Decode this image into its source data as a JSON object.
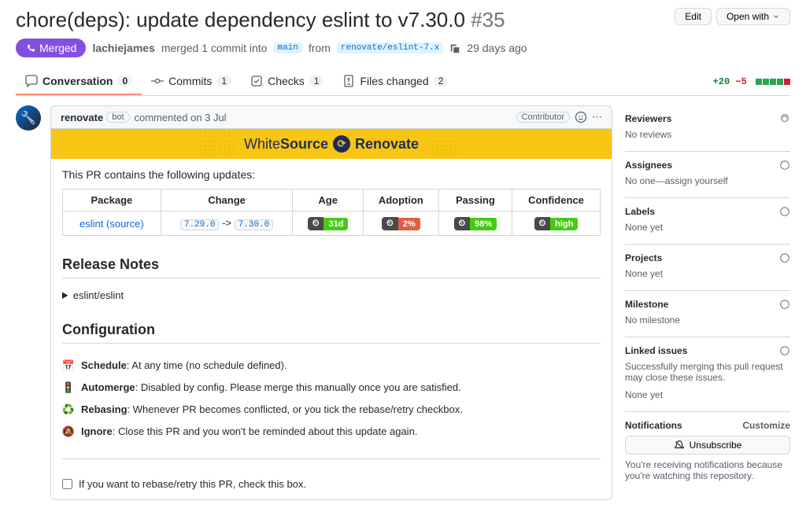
{
  "header": {
    "title": "chore(deps): update dependency eslint to v7.30.0",
    "issueNumber": "#35",
    "editBtn": "Edit",
    "openWithBtn": "Open with"
  },
  "state": {
    "badge": "Merged",
    "author": "lachiejames",
    "mergedText": "merged 1 commit into",
    "baseBranch": "main",
    "fromText": "from",
    "headBranch": "renovate/eslint-7.x",
    "timeAgo": "29 days ago"
  },
  "tabs": {
    "conversation": "Conversation",
    "conversationCount": "0",
    "commits": "Commits",
    "commitsCount": "1",
    "checks": "Checks",
    "checksCount": "1",
    "filesChanged": "Files changed",
    "filesChangedCount": "2",
    "additions": "+20",
    "deletions": "−5"
  },
  "comment": {
    "author": "renovate",
    "bot": "bot",
    "commentedText": "commented on 3 Jul",
    "contributor": "Contributor",
    "bannerLeft": "WhiteSource",
    "bannerRight": "Renovate",
    "introText": "This PR contains the following updates:",
    "table": {
      "headers": [
        "Package",
        "Change",
        "Age",
        "Adoption",
        "Passing",
        "Confidence"
      ],
      "package": "eslint",
      "sourceLabel": "(source)",
      "changeFrom": "7.29.0",
      "changeTo": "7.30.0",
      "arrow": "->",
      "age": "31d",
      "adoption": "2%",
      "passing": "98%",
      "confidence": "high"
    },
    "releaseNotesTitle": "Release Notes",
    "releaseNotesSummary": "eslint/eslint",
    "configTitle": "Configuration",
    "config": {
      "schedule": {
        "label": "Schedule",
        "text": ": At any time (no schedule defined)."
      },
      "automerge": {
        "label": "Automerge",
        "text": ": Disabled by config. Please merge this manually once you are satisfied."
      },
      "rebasing": {
        "label": "Rebasing",
        "text": ": Whenever PR becomes conflicted, or you tick the rebase/retry checkbox."
      },
      "ignore": {
        "label": "Ignore",
        "text": ": Close this PR and you won't be reminded about this update again."
      }
    },
    "checkboxText": "If you want to rebase/retry this PR, check this box."
  },
  "sidebar": {
    "reviewers": {
      "title": "Reviewers",
      "text": "No reviews"
    },
    "assignees": {
      "title": "Assignees",
      "text": "No one—",
      "link": "assign yourself"
    },
    "labels": {
      "title": "Labels",
      "text": "None yet"
    },
    "projects": {
      "title": "Projects",
      "text": "None yet"
    },
    "milestone": {
      "title": "Milestone",
      "text": "No milestone"
    },
    "linkedIssues": {
      "title": "Linked issues",
      "text": "Successfully merging this pull request may close these issues.",
      "none": "None yet"
    },
    "notifications": {
      "title": "Notifications",
      "customize": "Customize",
      "unsubscribe": "Unsubscribe",
      "reason": "You're receiving notifications because you're watching this repository."
    }
  }
}
